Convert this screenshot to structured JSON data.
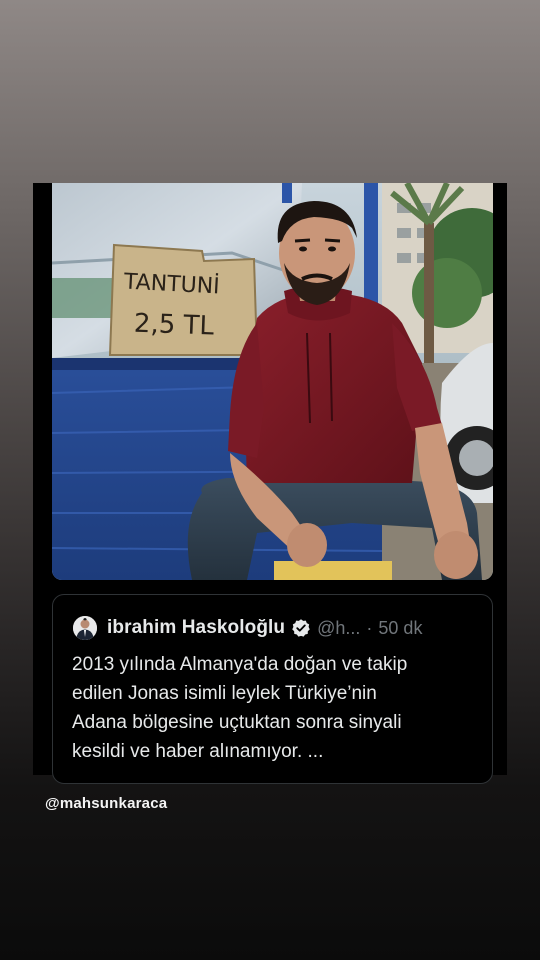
{
  "story": {
    "photo_sign_text": [
      "TANTUNİ",
      "2,5 TL"
    ],
    "tweet": {
      "display_name": "ibrahim Haskoloğlu",
      "handle": "@h...",
      "separator": "·",
      "time": "50 dk",
      "text": "2013 yılında Almanya'da doğan ve takip\nedilen Jonas isimli leylek Türkiye’nin\nAdana bölgesine uçtuktan sonra sinyali\nkesildi ve haber alınamıyor. ..."
    },
    "mention_sticker": "@mahsunkaraca"
  },
  "colors": {
    "tweet_background": "#000000",
    "tweet_text": "#e7e9ea",
    "tweet_meta": "#71767b",
    "verified_badge": "#e7e9ea"
  },
  "icons": {
    "verified": "verified-badge-icon"
  }
}
